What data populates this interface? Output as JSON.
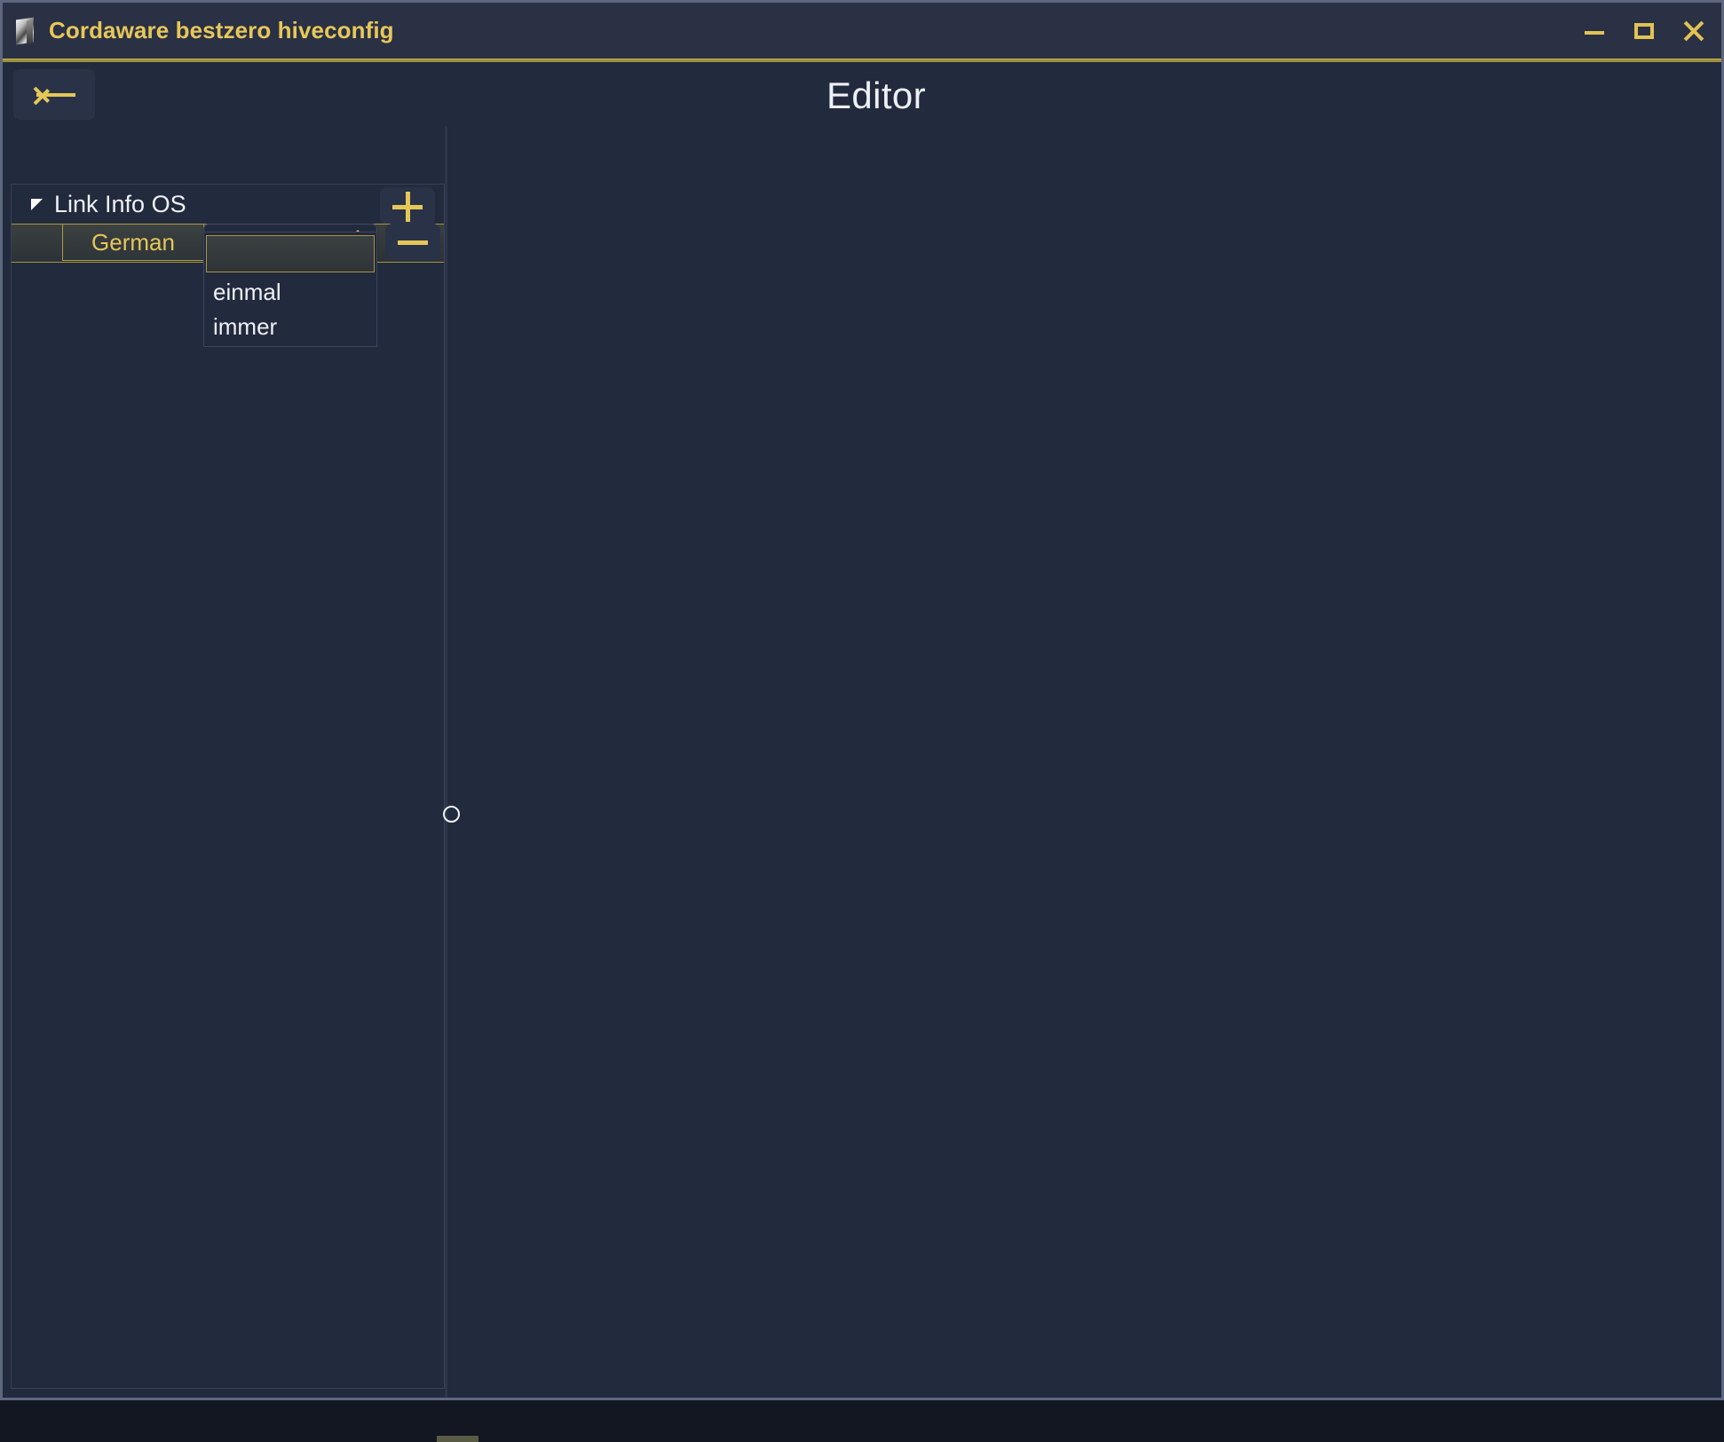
{
  "window": {
    "title": "Cordaware bestzero hiveconfig",
    "icon": "app-icon",
    "controls": {
      "minimize": "minimize-icon",
      "maximize": "maximize-icon",
      "close": "close-icon"
    }
  },
  "header": {
    "back_icon": "arrow-left-icon",
    "page_title": "Editor"
  },
  "tree": {
    "root": {
      "label": "Link Info OS",
      "expander_icon": "triangle-expanded-icon",
      "add_icon": "plus-icon"
    },
    "rows": [
      {
        "language": "German",
        "value": "",
        "remove_icon": "minus-icon",
        "spinner_icon": "updown-arrows-icon"
      }
    ]
  },
  "dropdown": {
    "open": true,
    "selected_index": 0,
    "options": [
      "",
      "einmal",
      "immer"
    ]
  },
  "colors": {
    "accent": "#e4c659",
    "window_bg": "#222a3d",
    "titlebar_bg": "#2a3145",
    "frame_border": "#5d6880",
    "text": "#eef1f6",
    "highlight_border": "#a8953f"
  }
}
